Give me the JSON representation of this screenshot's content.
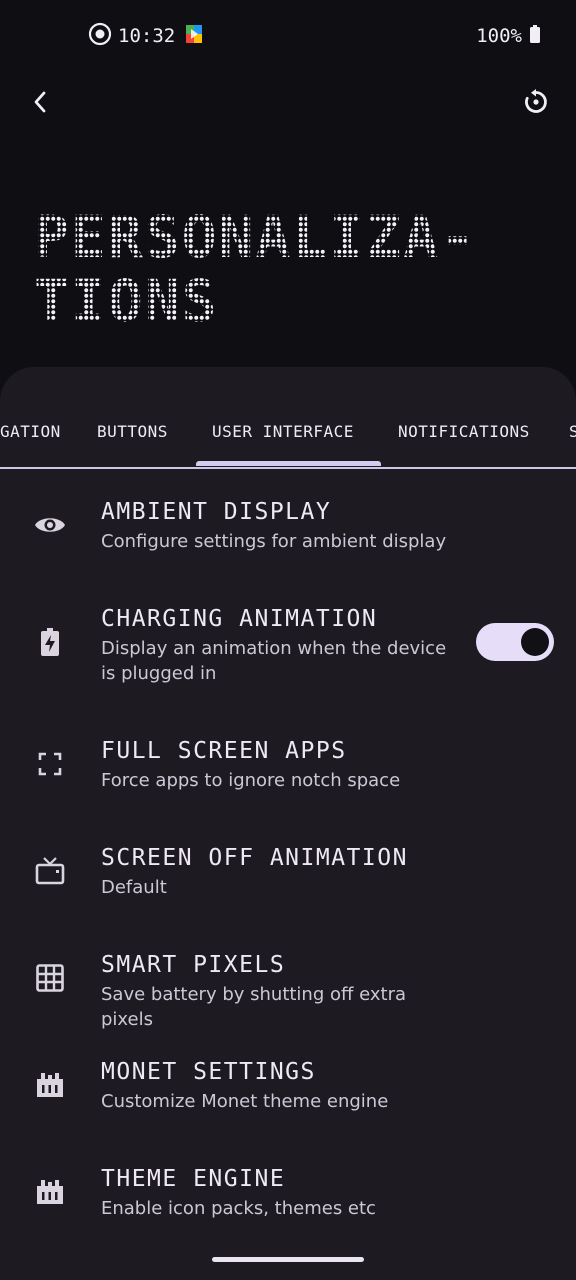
{
  "status_bar": {
    "time": "10:32",
    "battery": "100%"
  },
  "header": {
    "title_lines": [
      "PERSONALIZA-",
      "TIONS"
    ]
  },
  "tabs": [
    {
      "label": "GATION"
    },
    {
      "label": "BUTTONS"
    },
    {
      "label": "USER INTERFACE",
      "selected": true
    },
    {
      "label": "NOTIFICATIONS"
    },
    {
      "label": "S"
    }
  ],
  "items": [
    {
      "title": "AMBIENT DISPLAY",
      "subtitle": "Configure settings for ambient display",
      "icon": "eye-icon"
    },
    {
      "title": "CHARGING ANIMATION",
      "subtitle": "Display an animation when the device is plugged in",
      "icon": "battery-charging-icon",
      "toggle": true
    },
    {
      "title": "FULL SCREEN APPS",
      "subtitle": "Force apps to ignore notch space",
      "icon": "fullscreen-icon"
    },
    {
      "title": "SCREEN OFF ANIMATION",
      "subtitle": "Default",
      "icon": "tv-icon"
    },
    {
      "title": "SMART PIXELS",
      "subtitle": "Save battery by shutting off extra pixels",
      "icon": "grid-icon"
    },
    {
      "title": "MONET SETTINGS",
      "subtitle": "Customize Monet theme engine",
      "icon": "palette-icon"
    },
    {
      "title": "THEME ENGINE",
      "subtitle": "Enable icon packs, themes etc",
      "icon": "palette-icon"
    }
  ],
  "colors": {
    "background": "#0f0e12",
    "sheet": "#1d1b21",
    "accent": "#d4cbef"
  }
}
